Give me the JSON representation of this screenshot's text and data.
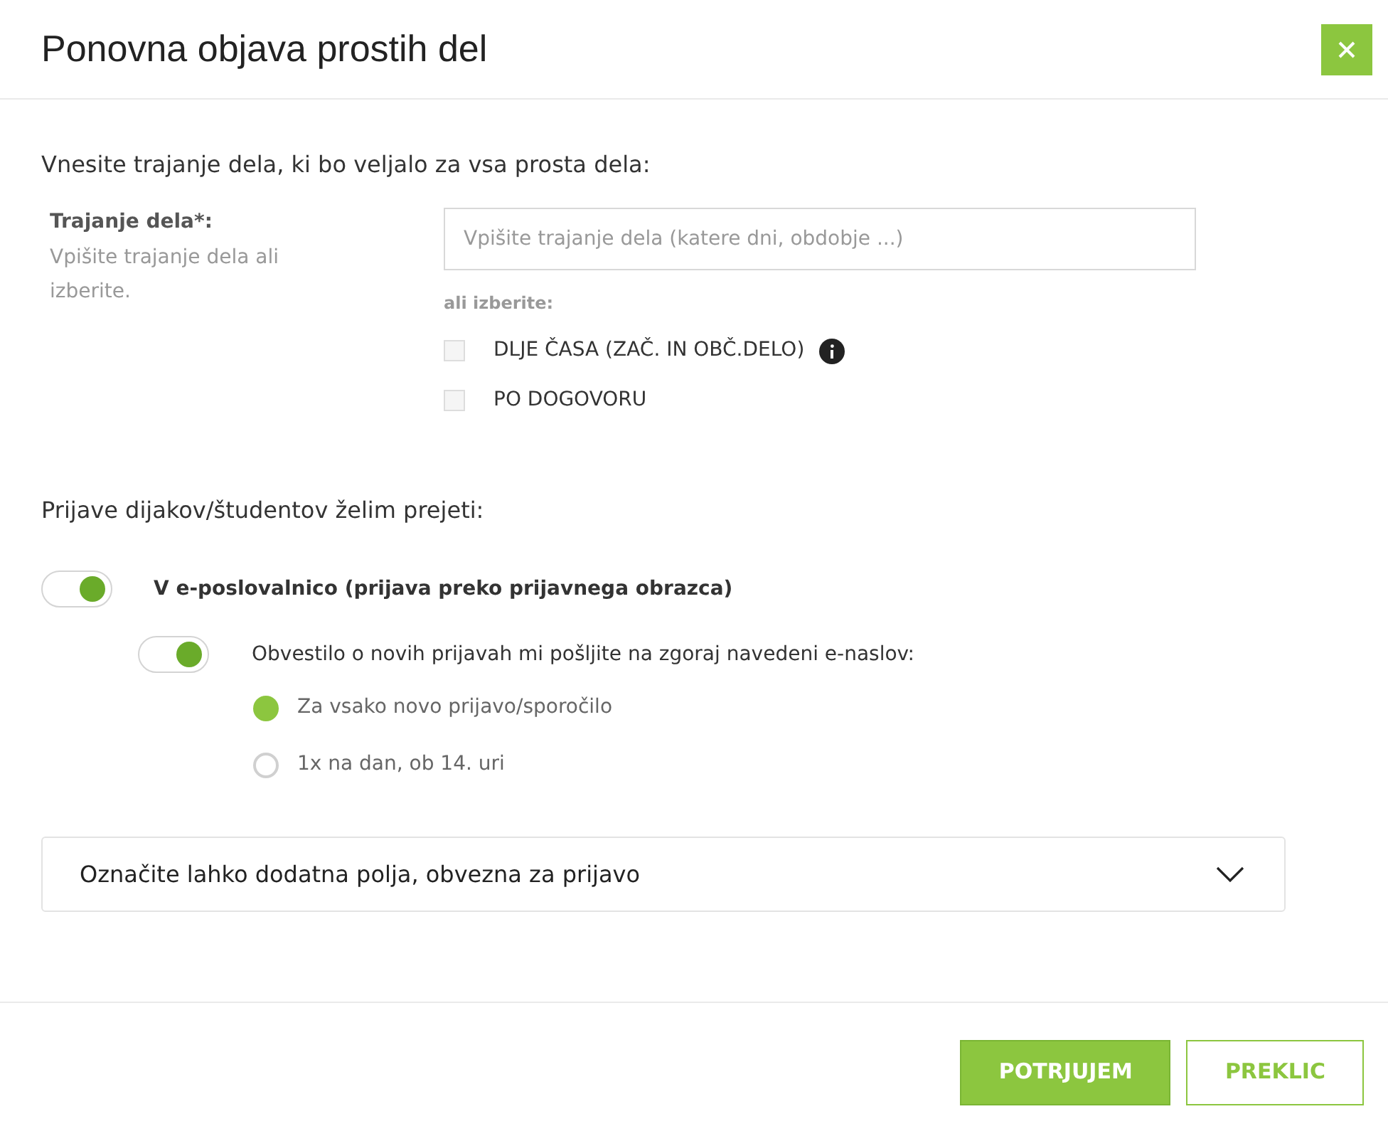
{
  "dialog": {
    "title": "Ponovna objava prostih del"
  },
  "duration": {
    "intro": "Vnesite trajanje dela, ki bo veljalo za vsa prosta dela:",
    "label": "Trajanje dela*:",
    "hint": "Vpišite trajanje dela ali izberite.",
    "placeholder": "Vpišite trajanje dela (katere dni, obdobje ...)",
    "or_label": "ali izberite:",
    "options": [
      {
        "label": "DLJE ČASA (ZAČ. IN OBČ.DELO)",
        "checked": false,
        "info": true
      },
      {
        "label": "PO DOGOVORU",
        "checked": false,
        "info": false
      }
    ]
  },
  "applications": {
    "intro": "Prijave dijakov/študentov želim prejeti:",
    "portal_toggle": {
      "label": "V e-poslovalnico (prijava preko prijavnega obrazca)",
      "on": true
    },
    "notify_toggle": {
      "label": "Obvestilo o novih prijavah mi pošljite na zgoraj navedeni e-naslov:",
      "on": true
    },
    "frequency": [
      {
        "label": "Za vsako novo prijavo/sporočilo",
        "selected": true
      },
      {
        "label": "1x na dan, ob 14. uri",
        "selected": false
      }
    ]
  },
  "extra_fields": {
    "label": "Označite lahko dodatna polja, obvezna za prijavo",
    "expanded": false
  },
  "buttons": [
    {
      "label": "POTRJUJEM",
      "kind": "primary"
    },
    {
      "label": "PREKLIC",
      "kind": "secondary"
    }
  ]
}
